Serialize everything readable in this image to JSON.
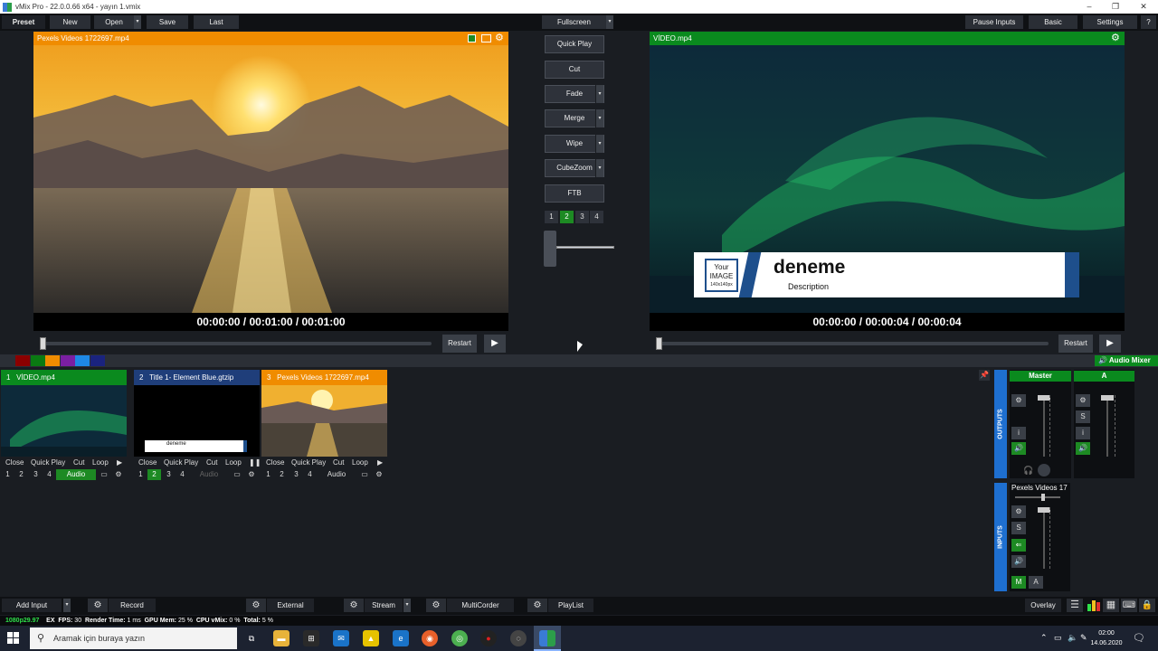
{
  "window": {
    "title": "vMix Pro - 22.0.0.66 x64 - yayın 1.vmix"
  },
  "toolbar": {
    "preset": "Preset",
    "new": "New",
    "open": "Open",
    "save": "Save",
    "last": "Last",
    "fullscreen": "Fullscreen",
    "pause_inputs": "Pause Inputs",
    "basic": "Basic",
    "settings": "Settings",
    "help": "?"
  },
  "preview": {
    "title": "Pexels Videos 1722697.mp4",
    "time": "00:00:00  /  00:01:00  /  00:01:00",
    "restart": "Restart"
  },
  "output": {
    "title": "VİDEO.mp4",
    "time": "00:00:00  /  00:00:04  /  00:00:04",
    "restart": "Restart",
    "lower_third": {
      "image_line1": "Your",
      "image_line2": "IMAGE",
      "image_line3": "140x140px",
      "title": "deneme",
      "description": "Description"
    }
  },
  "transitions": {
    "quick_play": "Quick Play",
    "cut": "Cut",
    "fade": "Fade",
    "merge": "Merge",
    "wipe": "Wipe",
    "cubezoom": "CubeZoom",
    "ftb": "FTB",
    "numbers": [
      "1",
      "2",
      "3",
      "4"
    ],
    "active_number": "2"
  },
  "audio_mixer_label": "Audio Mixer",
  "swatch_colors": [
    "#2b2f36",
    "#8b0000",
    "#0a7a12",
    "#f08c00",
    "#7b1fa2",
    "#1e88e5",
    "#1a237e"
  ],
  "inputs": [
    {
      "num": "1",
      "title": "VİDEO.mp4",
      "color": "#0a8a1e",
      "close": "Close",
      "quick_play": "Quick Play",
      "cut": "Cut",
      "loop": "Loop",
      "audio": "Audio",
      "audio_state": "on"
    },
    {
      "num": "2",
      "title": "Title 1- Element Blue.gtzip",
      "color": "#1f3e7a",
      "close": "Close",
      "quick_play": "Quick Play",
      "cut": "Cut",
      "loop": "Loop",
      "audio": "Audio",
      "audio_state": "dim",
      "thumb_text": "deneme"
    },
    {
      "num": "3",
      "title": "Pexels Videos 1722697.mp4",
      "color": "#f08c00",
      "close": "Close",
      "quick_play": "Quick Play",
      "cut": "Cut",
      "loop": "Loop",
      "audio": "Audio",
      "audio_state": "off"
    }
  ],
  "mixer": {
    "outputs_label": "OUTPUTS",
    "inputs_label": "INPUTS",
    "master": "Master",
    "bus_a": "A",
    "input_strip": "Pexels Videos 17",
    "mute_label": "M",
    "a_label": "A",
    "solo_label": "S",
    "info_label": "i"
  },
  "bottom": {
    "add_input": "Add Input",
    "record": "Record",
    "external": "External",
    "stream": "Stream",
    "multicorder": "MultiCorder",
    "playlist": "PlayList",
    "overlay": "Overlay"
  },
  "status": {
    "format": "1080p29.97",
    "ex": "EX",
    "fps_label": "FPS:",
    "fps": "30",
    "render_label": "Render Time:",
    "render": "1 ms",
    "gpu_label": "GPU Mem:",
    "gpu": "25 %",
    "cpu_label": "CPU vMix:",
    "cpu": "0 %",
    "total_label": "Total:",
    "total": "5 %"
  },
  "taskbar": {
    "search_placeholder": "Aramak için buraya yazın",
    "time": "02:00",
    "date": "14.06.2020"
  }
}
